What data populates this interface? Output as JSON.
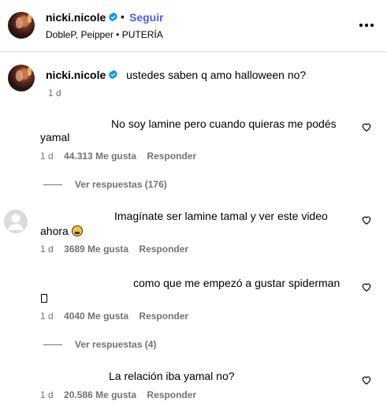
{
  "header": {
    "username": "nicki.nicole",
    "follow_label": "Seguir",
    "subtitle": "DobleP, Peipper • PUTERÍA",
    "more_icon": "more-horizontal-icon"
  },
  "caption": {
    "username": "nicki.nicole",
    "text": "ustedes saben q amo halloween no?",
    "time": "1 d"
  },
  "comments": [
    {
      "line1": "No soy lamine pero cuando quieras me podés",
      "line2": "yamal",
      "time": "1 d",
      "likes": "44.313 Me gusta",
      "reply": "Responder",
      "view_replies": "Ver respuestas (176)"
    },
    {
      "line1": "Imagínate ser lamine tamal y ver este video",
      "line2": "ahora",
      "time": "1 d",
      "likes": "3689 Me gusta",
      "reply": "Responder"
    },
    {
      "line1": "como que me empezó a gustar spiderman",
      "time": "1 d",
      "likes": "4040 Me gusta",
      "reply": "Responder",
      "view_replies": "Ver respuestas (4)"
    },
    {
      "line1": "La relación iba yamal no?",
      "time": "1 d",
      "likes": "20.586 Me gusta",
      "reply": "Responder"
    }
  ],
  "colors": {
    "link_blue": "#4a5df9",
    "secondary_text": "#737373",
    "verified_blue": "#0095f6"
  }
}
